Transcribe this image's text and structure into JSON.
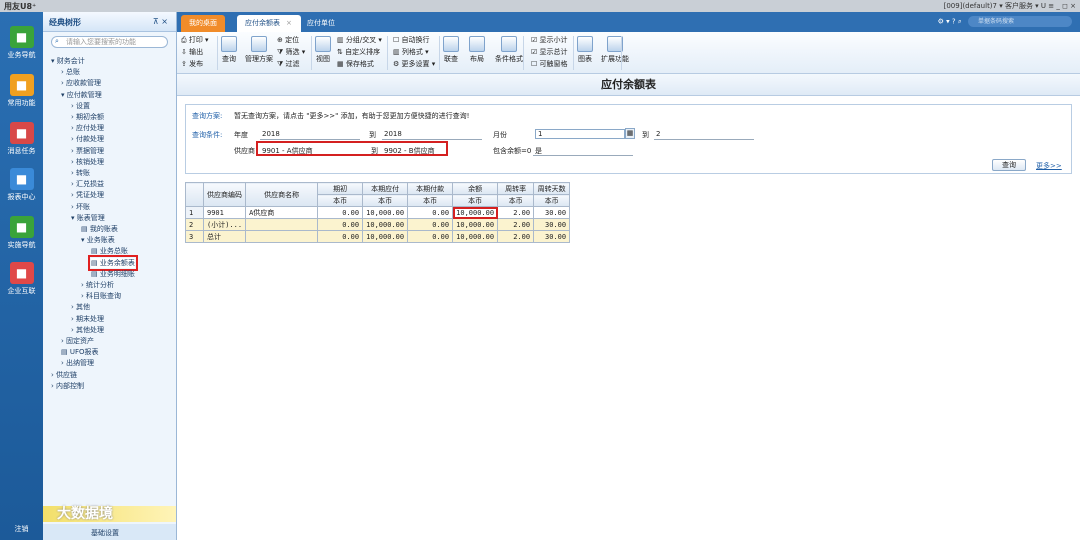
{
  "app": {
    "logo": "用友U8⁺",
    "titlebar_right": "[009](default)7   ▾  客户服务 ▾  U  ≡  _  ◻  ×"
  },
  "nav": {
    "items": [
      {
        "label": "业务导航",
        "icon": "grid-icon",
        "color": "#3aa33a"
      },
      {
        "label": "常用功能",
        "icon": "star-icon",
        "color": "#f0a020"
      },
      {
        "label": "消息任务",
        "icon": "message-icon",
        "color": "#d84848"
      },
      {
        "label": "报表中心",
        "icon": "report-icon",
        "color": "#3a8ad8"
      },
      {
        "label": "实施导航",
        "icon": "compass-icon",
        "color": "#3aa33a"
      },
      {
        "label": "企业互联",
        "icon": "connect-icon",
        "color": "#e04848"
      }
    ],
    "logout": "注销"
  },
  "tree": {
    "title": "经典树形",
    "pin": "⊼ ×",
    "search_placeholder": "请输入您要搜索的功能",
    "nodes": [
      {
        "text": "▾ 财务会计",
        "level": 0
      },
      {
        "text": "› 总账",
        "level": 1
      },
      {
        "text": "› 应收款管理",
        "level": 1
      },
      {
        "text": "▾ 应付款管理",
        "level": 1
      },
      {
        "text": "› 设置",
        "level": 2
      },
      {
        "text": "› 期初余额",
        "level": 2
      },
      {
        "text": "› 应付处理",
        "level": 2
      },
      {
        "text": "› 付款处理",
        "level": 2
      },
      {
        "text": "› 票据管理",
        "level": 2
      },
      {
        "text": "› 核销处理",
        "level": 2
      },
      {
        "text": "› 转账",
        "level": 2
      },
      {
        "text": "› 汇兑损益",
        "level": 2
      },
      {
        "text": "› 凭证处理",
        "level": 2
      },
      {
        "text": "› 坏账",
        "level": 2
      },
      {
        "text": "▾ 账表管理",
        "level": 2
      },
      {
        "text": "▤ 我的账表",
        "level": 3
      },
      {
        "text": "▾ 业务账表",
        "level": 3
      },
      {
        "text": "▤ 业务总账",
        "level": 4
      },
      {
        "text": "▤ 业务余额表",
        "level": 4,
        "selected": true
      },
      {
        "text": "▤ 业务明细账",
        "level": 4
      },
      {
        "text": "› 统计分析",
        "level": 3
      },
      {
        "text": "› 科目账查询",
        "level": 3
      },
      {
        "text": "› 其他",
        "level": 2
      },
      {
        "text": "› 期末处理",
        "level": 2
      },
      {
        "text": "› 其他处理",
        "level": 2
      },
      {
        "text": "› 固定资产",
        "level": 1
      },
      {
        "text": "▤ UFO报表",
        "level": 1
      },
      {
        "text": "› 出纳管理",
        "level": 1
      },
      {
        "text": "› 供应链",
        "level": 0
      },
      {
        "text": "› 内部控制",
        "level": 0
      }
    ],
    "banner": "大数据境",
    "footer": "基础设置"
  },
  "tabs": {
    "home": "我的桌面",
    "active": "应付余额表",
    "close": "×",
    "other": "应付单位",
    "search_placeholder": "单据条码搜索"
  },
  "ribbon": {
    "small": [
      {
        "text": "⎙ 打印 ▾"
      },
      {
        "text": "⇩ 输出"
      },
      {
        "text": "⇪ 发布"
      },
      {
        "text": "⊕ 定位"
      },
      {
        "text": "⧩ 筛选 ▾"
      },
      {
        "text": "⧩ 过滤"
      },
      {
        "text": "▥ 分组/交叉 ▾"
      },
      {
        "text": "⇅ 自定义排序"
      },
      {
        "text": "▦ 保存格式"
      },
      {
        "text": "☐ 自动换行"
      },
      {
        "text": "▥ 列格式 ▾"
      },
      {
        "text": "⚙ 更多设置 ▾"
      },
      {
        "text": "☑ 显示小计"
      },
      {
        "text": "☑ 显示总计"
      },
      {
        "text": "☐ 可触窗格"
      }
    ],
    "big": [
      {
        "text": "查询"
      },
      {
        "text": "管理方案"
      },
      {
        "text": "视图"
      },
      {
        "text": "联查"
      },
      {
        "text": "布局"
      },
      {
        "text": "条件格式"
      },
      {
        "text": "图表"
      },
      {
        "text": "扩展功能"
      }
    ]
  },
  "page_title": "应付余额表",
  "query": {
    "scheme_label": "查询方案:",
    "scheme_text": "暂无查询方案，请点击 \"更多>>\" 添加，有助于您更加方便快捷的进行查询!",
    "cond_label": "查询条件:",
    "year_label": "年度",
    "year_from": "2018",
    "year_to_label": "到",
    "year_to": "2018",
    "month_label": "月份",
    "month_from": "1",
    "month_to_label": "到",
    "month_to": "2",
    "supplier_label": "供应商",
    "supplier_from": "9901 - A供应商",
    "supplier_to_label": "到",
    "supplier_to": "9902 - B供应商",
    "balance_label": "包含余额=0",
    "balance_value": "是",
    "query_button": "查询",
    "more_link": "更多>>"
  },
  "grid": {
    "headers": [
      "供应商编码",
      "供应商名称",
      "期初",
      "本期应付",
      "本期付款",
      "余额",
      "周转率",
      "周转天数"
    ],
    "subheader": "本币",
    "rows": [
      {
        "no": "1",
        "code": "9901",
        "name": "A供应商",
        "begin": "0.00",
        "payable": "10,000.00",
        "paid": "0.00",
        "balance": "10,000.00",
        "rate": "2.00",
        "days": "30.00",
        "type": "data"
      },
      {
        "no": "2",
        "code": "(小计)...",
        "name": "",
        "begin": "0.00",
        "payable": "10,000.00",
        "paid": "0.00",
        "balance": "10,000.00",
        "rate": "2.00",
        "days": "30.00",
        "type": "sub"
      },
      {
        "no": "3",
        "code": "总计",
        "name": "",
        "begin": "0.00",
        "payable": "10,000.00",
        "paid": "0.00",
        "balance": "10,000.00",
        "rate": "2.00",
        "days": "30.00",
        "type": "tot"
      }
    ]
  }
}
